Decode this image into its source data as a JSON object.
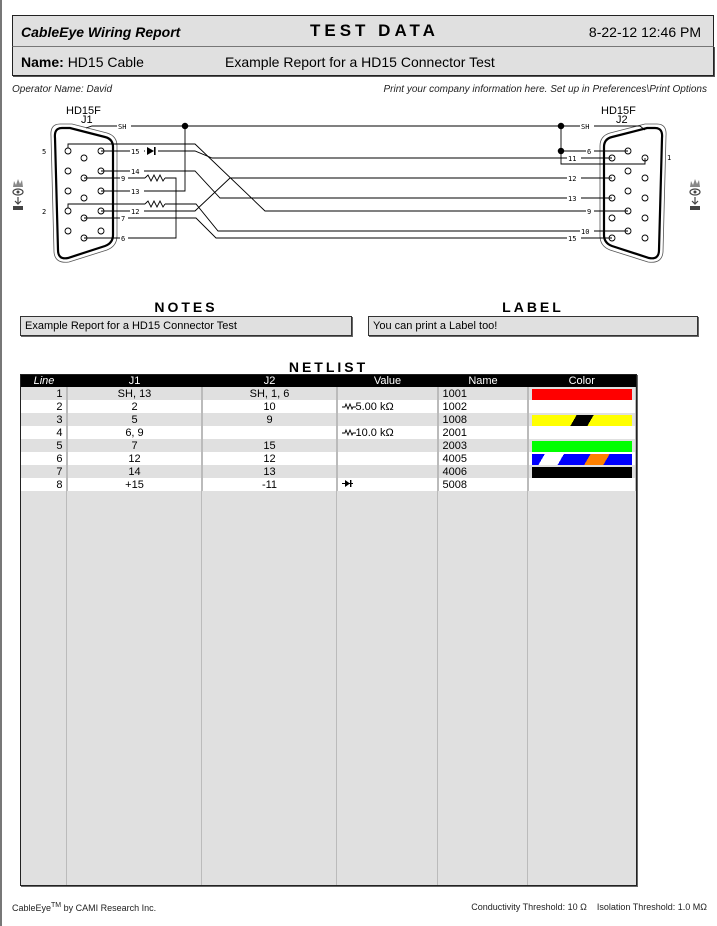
{
  "header": {
    "app_title": "CableEye Wiring Report",
    "report_type": "TEST DATA",
    "datetime": "8-22-12  12:46 PM",
    "name_label": "Name:",
    "name_value": "HD15 Cable",
    "description": "Example Report for a HD15 Connector Test"
  },
  "meta": {
    "operator": "Operator Name: David",
    "company_info": "Print your company information here. Set up in Preferences\\Print Options"
  },
  "diagram": {
    "left_connector": {
      "type": "HD15F",
      "id": "J1",
      "pin_label_top": "5",
      "pin_label_bottom": "2"
    },
    "right_connector": {
      "type": "HD15F",
      "id": "J2",
      "pin_label": "1"
    },
    "wire_labels_left": [
      "SH",
      "15",
      "14",
      "9",
      "13",
      "12",
      "7",
      "6"
    ],
    "wire_labels_right": [
      "SH",
      "6",
      "11",
      "12",
      "13",
      "9",
      "10",
      "15"
    ]
  },
  "notes": {
    "title": "NOTES",
    "text": "Example Report for a HD15 Connector Test"
  },
  "label": {
    "title": "LABEL",
    "text": "You can print a Label too!"
  },
  "netlist": {
    "title": "NETLIST",
    "columns": [
      "Line",
      "J1",
      "J2",
      "Value",
      "Name",
      "Color"
    ],
    "rows": [
      {
        "line": "1",
        "j1": "SH, 13",
        "j2": "SH, 1, 6",
        "value": "",
        "value_icon": "",
        "name": "1001",
        "color": {
          "base": "#ff0000",
          "stripes": []
        }
      },
      {
        "line": "2",
        "j1": "2",
        "j2": "10",
        "value": "5.00 kΩ",
        "value_icon": "resistor-icon",
        "name": "1002",
        "color": null
      },
      {
        "line": "3",
        "j1": "5",
        "j2": "9",
        "value": "",
        "value_icon": "",
        "name": "1008",
        "color": {
          "base": "#ffff00",
          "stripes": [
            "#000000"
          ]
        }
      },
      {
        "line": "4",
        "j1": "6, 9",
        "j2": "",
        "value": "10.0 kΩ",
        "value_icon": "resistor-icon",
        "name": "2001",
        "color": null
      },
      {
        "line": "5",
        "j1": "7",
        "j2": "15",
        "value": "",
        "value_icon": "",
        "name": "2003",
        "color": {
          "base": "#00ff00",
          "stripes": []
        }
      },
      {
        "line": "6",
        "j1": "12",
        "j2": "12",
        "value": "",
        "value_icon": "",
        "name": "4005",
        "color": {
          "base": "#0000ff",
          "stripes": [
            "#ffffff",
            "#ff8000"
          ]
        }
      },
      {
        "line": "7",
        "j1": "14",
        "j2": "13",
        "value": "",
        "value_icon": "",
        "name": "4006",
        "color": {
          "base": "#000000",
          "stripes": []
        }
      },
      {
        "line": "8",
        "j1": "+15",
        "j2": "-11",
        "value": "",
        "value_icon": "diode-icon",
        "name": "5008",
        "color": null
      }
    ]
  },
  "footer": {
    "brand": "CableEye",
    "tm": "TM",
    "brand_suffix": " by CAMI Research Inc.",
    "thresholds": "Conductivity Threshold: 10 Ω    Isolation Threshold: 1.0 MΩ"
  }
}
